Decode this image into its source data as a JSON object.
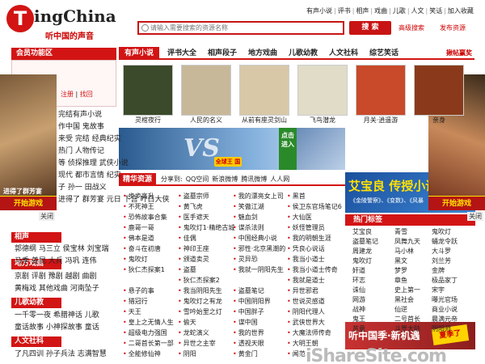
{
  "header": {
    "logo_letter": "T",
    "logo_word": "ingChina",
    "slogan": "听中国的声音",
    "top_nav": [
      "有声小说",
      "评书",
      "相声",
      "戏曲",
      "儿歌",
      "人文",
      "笑话",
      "加入收藏"
    ],
    "search_placeholder": "请输入需要搜索的资源名称",
    "search_button": "搜 索",
    "advanced_search": "高级搜索",
    "publish_resource": "发布资源"
  },
  "member": {
    "title": "会员功能区",
    "register": "注册",
    "forgot": "找回"
  },
  "left_categories": {
    "lines_top": [
      "完结有声小说",
      "作中国  鬼故事",
      "来受 完结  经典纪实",
      "热门  人物传记",
      "等 侦探推理  武侠小说",
      "现代 都市言情  纪实",
      "子  孙一  田战义",
      "进得了 群芳宴  元日  下宫 叶白大侠"
    ],
    "crosstalk_title": "相声",
    "crosstalk_lines": [
      "郭德纲  马三立  侯宝林  刘宝瑞",
      "马季  姜昆  大兵  冯巩  连伟"
    ],
    "drama_title": "地方戏曲",
    "drama_lines": [
      "京剧  评剧  豫剧  越剧  曲剧",
      "黄梅戏  其他戏曲  河南坠子"
    ],
    "kids_title": "儿歌幼教",
    "kids_lines": [
      "一千零一夜  希腊神话  儿歌",
      "童话故事  小神探故事  童话"
    ],
    "culture_title": "人文社科",
    "culture_lines": [
      "了凡四训  孙子兵法  志满智慧"
    ]
  },
  "tabs": [
    "有声小说",
    "评书大全",
    "相声段子",
    "地方戏曲",
    "儿歌幼教",
    "人文社科",
    "综艺笑话"
  ],
  "prize_link": "揪帖赢奖",
  "books": [
    {
      "title": "灵棺夜行",
      "color": "#3a4a2a"
    },
    {
      "title": "人民的名义",
      "color": "#c8b89a"
    },
    {
      "title": "从前有座灵剑山",
      "color": "#d8c8a8"
    },
    {
      "title": "飞鸟潜龙",
      "color": "#e0dcc8"
    },
    {
      "title": "月关·逍遥游",
      "color": "#c84a2a"
    },
    {
      "title": "亲身",
      "color": "#8a3a1a"
    }
  ],
  "banner": {
    "vs": "VS",
    "tag": "全球王 国",
    "side_text": "点击进入"
  },
  "curated": {
    "title": "精华资源",
    "share": [
      "分享到:",
      "QQ空间",
      "新浪微博",
      "腾讯微博",
      "人人网"
    ],
    "columns": [
      [
        "步步高升",
        "不死神王",
        "恐怖故事合集",
        "鹿哥一哥",
        "佛本是道",
        "奋斗在初唐",
        "鬼吹灯",
        "狄仁杰探案1"
      ],
      [
        "盗墓宗师",
        "黄飞虎",
        "医手遮天",
        "鬼吹灯1·精绝古城",
        "佳偶",
        "神印王座",
        "颁道卖灵",
        "盗墓",
        "狄仁杰探案2"
      ],
      [
        "我的漂亮女上司",
        "笑傲江湖",
        "魅血剑",
        "谍杀法则",
        "中国经典小说",
        "邪性·北京黑潮的",
        "灵异恐",
        "我就一阴阳先生"
      ],
      [
        "黑首",
        "侯卫东官场笔记6",
        "大仙医",
        "妖怪管理员",
        "我的明朝生涯",
        "凭良心说话",
        "我当小道士",
        "我当小道士传奇",
        "我就是道士"
      ]
    ],
    "bottom_columns": [
      [
        "悬子的事",
        "猎冠行",
        "天王",
        "皇上之无情人生",
        "超级电力强国",
        "二哥首长第一部",
        "全能修仙神"
      ],
      [
        "我当阴阳先生",
        "鬼吹灯之有龙",
        "雪吟始里之灯",
        "偷天",
        "龙蛇演义",
        "异世之主宰",
        "阴阳"
      ],
      [
        "盗墓笔记",
        "中国阴阳界",
        "中国胖子",
        "谍中国",
        "我的世界",
        "透视天眼",
        "黄金门"
      ],
      [
        "异世邪君",
        "世说灵感道",
        "阴阳代理人",
        "武侠世界大",
        "大魔法师传奇",
        "大明王朝",
        "闻范"
      ]
    ]
  },
  "promo": {
    "title": "艾宝良 传授小说",
    "subtitle": "《金陵警察》、《变数》、《风暴"
  },
  "hot": {
    "title": "热门标签",
    "columns": [
      [
        "艾宝良",
        "盗墓笔记",
        "周建龙",
        "鬼吹灯",
        "奸道",
        "环志",
        "诛仙",
        "网游",
        "战神",
        "鬼王",
        "苏童"
      ],
      [
        "青雪",
        "凤舞九天",
        "马小林",
        "黑文",
        "梦罗",
        "章鱼",
        "史上第一",
        "黑社会",
        "仙逆",
        "二号首长",
        "斗罗大陆"
      ],
      [
        "鬼吹灯",
        "蛹龙令跃",
        "大斗罗",
        "刘兰芳",
        "金牌",
        "极品家丁",
        "宋宇",
        "曝光官场",
        "商业小说",
        "晨满元帝",
        "阴阳师"
      ]
    ]
  },
  "season": {
    "text": "听中国季·新机遇",
    "badge": "夏季了"
  },
  "ads": {
    "left_caption": "进得了群芳宴",
    "label": "开始游戏",
    "close": "关闭"
  },
  "watermark": "iShareSite.com"
}
